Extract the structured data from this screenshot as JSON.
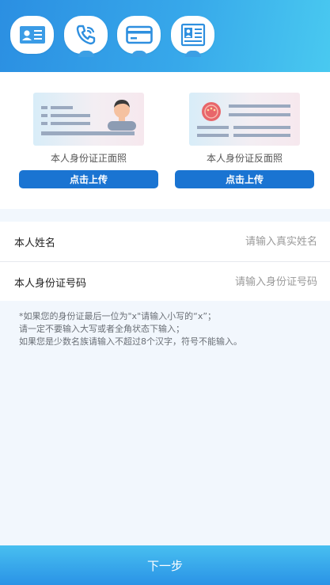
{
  "steps": [
    {
      "icon": "id-card-icon"
    },
    {
      "icon": "phone-icon"
    },
    {
      "icon": "bank-card-icon"
    },
    {
      "icon": "profile-document-icon"
    }
  ],
  "upload": {
    "front": {
      "caption": "本人身份证正面照",
      "button": "点击上传"
    },
    "back": {
      "caption": "本人身份证反面照",
      "button": "点击上传"
    }
  },
  "form": {
    "name": {
      "label": "本人姓名",
      "placeholder": "请输入真实姓名",
      "value": ""
    },
    "id_number": {
      "label": "本人身份证号码",
      "placeholder": "请输入身份证号码",
      "value": ""
    }
  },
  "notes": [
    "*如果您的身份证最后一位为\"x\"请输入小写的“x”；",
    "请一定不要输入大写或者全角状态下输入；",
    "如果您是少数名族请输入不超过8个汉字，符号不能输入。"
  ],
  "next_button": "下一步",
  "colors": {
    "header_start": "#2b8fe2",
    "header_end": "#49c9f0",
    "upload_button": "#1a74d2",
    "next_button_top": "#48bff0",
    "next_button_bottom": "#2a93e6",
    "page_background": "#f2f7fd"
  }
}
